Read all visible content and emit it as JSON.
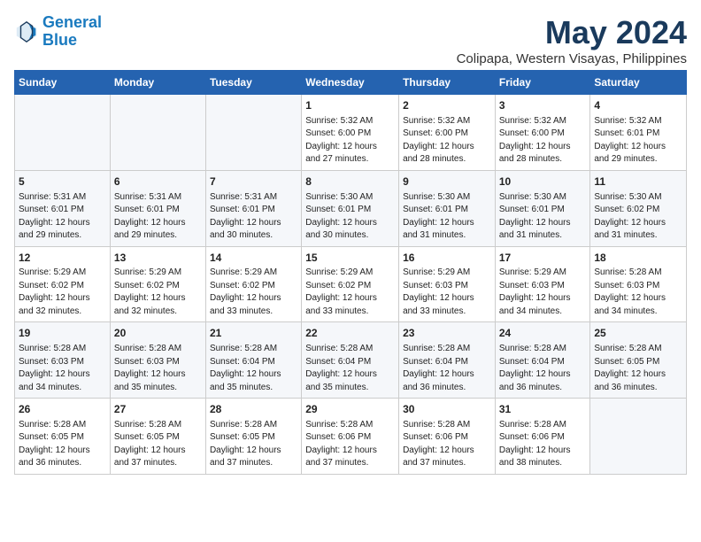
{
  "header": {
    "logo_line1": "General",
    "logo_line2": "Blue",
    "month_year": "May 2024",
    "location": "Colipapa, Western Visayas, Philippines"
  },
  "days_of_week": [
    "Sunday",
    "Monday",
    "Tuesday",
    "Wednesday",
    "Thursday",
    "Friday",
    "Saturday"
  ],
  "weeks": [
    [
      {
        "day": "",
        "info": ""
      },
      {
        "day": "",
        "info": ""
      },
      {
        "day": "",
        "info": ""
      },
      {
        "day": "1",
        "info": "Sunrise: 5:32 AM\nSunset: 6:00 PM\nDaylight: 12 hours\nand 27 minutes."
      },
      {
        "day": "2",
        "info": "Sunrise: 5:32 AM\nSunset: 6:00 PM\nDaylight: 12 hours\nand 28 minutes."
      },
      {
        "day": "3",
        "info": "Sunrise: 5:32 AM\nSunset: 6:00 PM\nDaylight: 12 hours\nand 28 minutes."
      },
      {
        "day": "4",
        "info": "Sunrise: 5:32 AM\nSunset: 6:01 PM\nDaylight: 12 hours\nand 29 minutes."
      }
    ],
    [
      {
        "day": "5",
        "info": "Sunrise: 5:31 AM\nSunset: 6:01 PM\nDaylight: 12 hours\nand 29 minutes."
      },
      {
        "day": "6",
        "info": "Sunrise: 5:31 AM\nSunset: 6:01 PM\nDaylight: 12 hours\nand 29 minutes."
      },
      {
        "day": "7",
        "info": "Sunrise: 5:31 AM\nSunset: 6:01 PM\nDaylight: 12 hours\nand 30 minutes."
      },
      {
        "day": "8",
        "info": "Sunrise: 5:30 AM\nSunset: 6:01 PM\nDaylight: 12 hours\nand 30 minutes."
      },
      {
        "day": "9",
        "info": "Sunrise: 5:30 AM\nSunset: 6:01 PM\nDaylight: 12 hours\nand 31 minutes."
      },
      {
        "day": "10",
        "info": "Sunrise: 5:30 AM\nSunset: 6:01 PM\nDaylight: 12 hours\nand 31 minutes."
      },
      {
        "day": "11",
        "info": "Sunrise: 5:30 AM\nSunset: 6:02 PM\nDaylight: 12 hours\nand 31 minutes."
      }
    ],
    [
      {
        "day": "12",
        "info": "Sunrise: 5:29 AM\nSunset: 6:02 PM\nDaylight: 12 hours\nand 32 minutes."
      },
      {
        "day": "13",
        "info": "Sunrise: 5:29 AM\nSunset: 6:02 PM\nDaylight: 12 hours\nand 32 minutes."
      },
      {
        "day": "14",
        "info": "Sunrise: 5:29 AM\nSunset: 6:02 PM\nDaylight: 12 hours\nand 33 minutes."
      },
      {
        "day": "15",
        "info": "Sunrise: 5:29 AM\nSunset: 6:02 PM\nDaylight: 12 hours\nand 33 minutes."
      },
      {
        "day": "16",
        "info": "Sunrise: 5:29 AM\nSunset: 6:03 PM\nDaylight: 12 hours\nand 33 minutes."
      },
      {
        "day": "17",
        "info": "Sunrise: 5:29 AM\nSunset: 6:03 PM\nDaylight: 12 hours\nand 34 minutes."
      },
      {
        "day": "18",
        "info": "Sunrise: 5:28 AM\nSunset: 6:03 PM\nDaylight: 12 hours\nand 34 minutes."
      }
    ],
    [
      {
        "day": "19",
        "info": "Sunrise: 5:28 AM\nSunset: 6:03 PM\nDaylight: 12 hours\nand 34 minutes."
      },
      {
        "day": "20",
        "info": "Sunrise: 5:28 AM\nSunset: 6:03 PM\nDaylight: 12 hours\nand 35 minutes."
      },
      {
        "day": "21",
        "info": "Sunrise: 5:28 AM\nSunset: 6:04 PM\nDaylight: 12 hours\nand 35 minutes."
      },
      {
        "day": "22",
        "info": "Sunrise: 5:28 AM\nSunset: 6:04 PM\nDaylight: 12 hours\nand 35 minutes."
      },
      {
        "day": "23",
        "info": "Sunrise: 5:28 AM\nSunset: 6:04 PM\nDaylight: 12 hours\nand 36 minutes."
      },
      {
        "day": "24",
        "info": "Sunrise: 5:28 AM\nSunset: 6:04 PM\nDaylight: 12 hours\nand 36 minutes."
      },
      {
        "day": "25",
        "info": "Sunrise: 5:28 AM\nSunset: 6:05 PM\nDaylight: 12 hours\nand 36 minutes."
      }
    ],
    [
      {
        "day": "26",
        "info": "Sunrise: 5:28 AM\nSunset: 6:05 PM\nDaylight: 12 hours\nand 36 minutes."
      },
      {
        "day": "27",
        "info": "Sunrise: 5:28 AM\nSunset: 6:05 PM\nDaylight: 12 hours\nand 37 minutes."
      },
      {
        "day": "28",
        "info": "Sunrise: 5:28 AM\nSunset: 6:05 PM\nDaylight: 12 hours\nand 37 minutes."
      },
      {
        "day": "29",
        "info": "Sunrise: 5:28 AM\nSunset: 6:06 PM\nDaylight: 12 hours\nand 37 minutes."
      },
      {
        "day": "30",
        "info": "Sunrise: 5:28 AM\nSunset: 6:06 PM\nDaylight: 12 hours\nand 37 minutes."
      },
      {
        "day": "31",
        "info": "Sunrise: 5:28 AM\nSunset: 6:06 PM\nDaylight: 12 hours\nand 38 minutes."
      },
      {
        "day": "",
        "info": ""
      }
    ]
  ]
}
